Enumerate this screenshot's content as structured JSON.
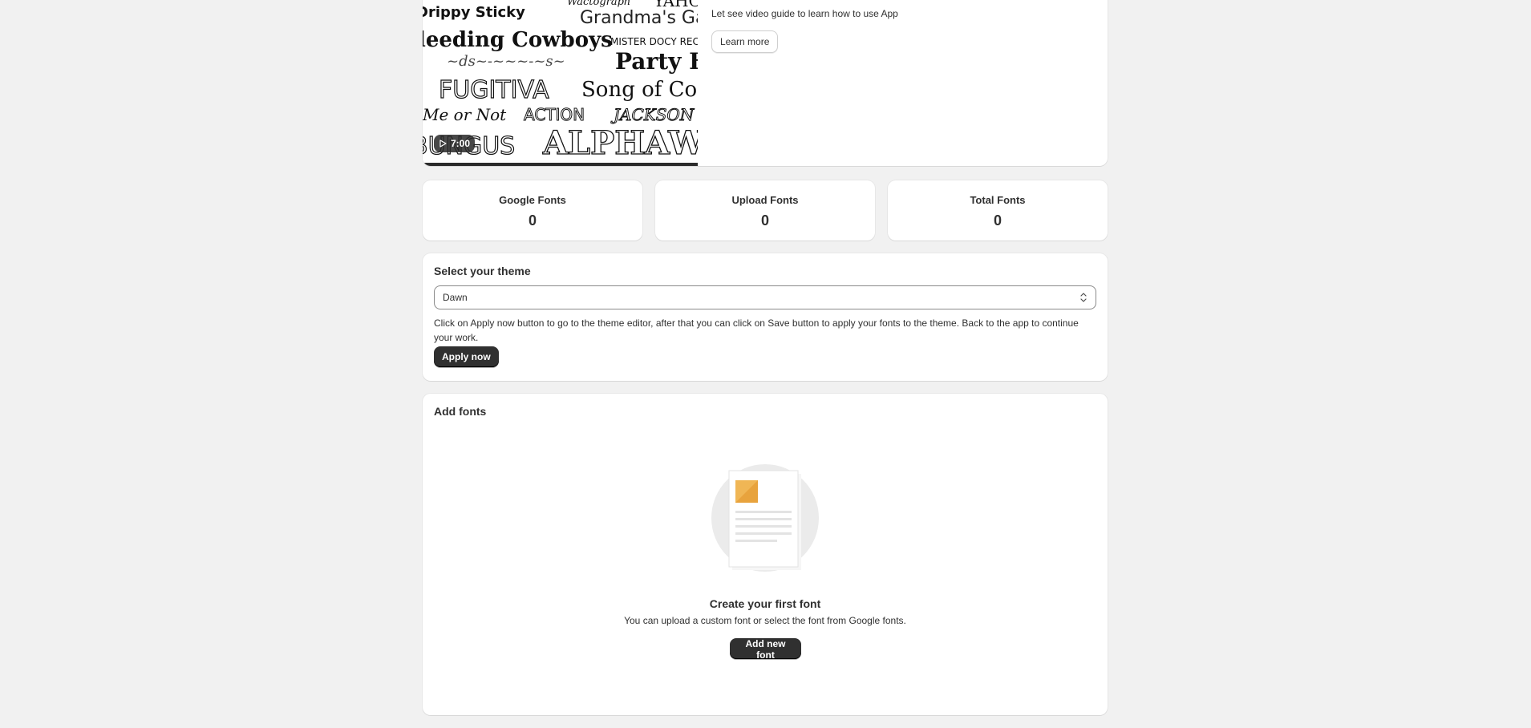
{
  "video": {
    "duration": "7:00",
    "description": "Let see video guide to learn how to use App",
    "learn_more_label": "Learn more",
    "thumbnail_words": [
      "Wactograph",
      "YAHO",
      "Drippy Sticky",
      "Grandma's Gar",
      "Bleeding Cowboys",
      "MISTER DOCY RECU",
      "Party Ho",
      "FUGITIVA",
      "Song of Con",
      "Me or Not",
      "ACTION",
      "JACKSON",
      "BUNGUS",
      "ALPHAWO"
    ]
  },
  "stats": [
    {
      "label": "Google Fonts",
      "value": "0"
    },
    {
      "label": "Upload Fonts",
      "value": "0"
    },
    {
      "label": "Total Fonts",
      "value": "0"
    }
  ],
  "theme": {
    "title": "Select your theme",
    "selected": "Dawn",
    "help": "Click on Apply now button to go to the theme editor, after that you can click on Save button to apply your fonts to the theme. Back to the app to continue your work.",
    "apply_label": "Apply now"
  },
  "add_fonts": {
    "title": "Add fonts",
    "empty_title": "Create your first font",
    "empty_desc": "You can upload a custom font or select the font from Google fonts.",
    "add_label": "Add new font"
  },
  "icons": {
    "play": "play-icon",
    "select": "select-chevrons-icon",
    "empty": "document-illustration"
  },
  "colors": {
    "background": "#f1f1f1",
    "card": "#ffffff",
    "primary_button": "#303030",
    "illustration_accent": "#e8a33d"
  }
}
